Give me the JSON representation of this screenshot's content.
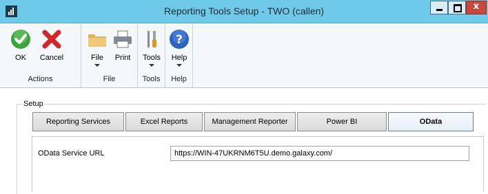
{
  "window": {
    "title": "Reporting Tools Setup  -  TWO (callen)",
    "icons": [
      "app-icon",
      "minimize-icon",
      "maximize-icon",
      "close-icon"
    ]
  },
  "ribbon": {
    "groups": [
      {
        "label": "Actions",
        "buttons": [
          {
            "label": "OK",
            "icon": "checkmark-icon",
            "color": "#3aa33a"
          },
          {
            "label": "Cancel",
            "icon": "x-icon",
            "color": "#d0282a"
          }
        ]
      },
      {
        "label": "File",
        "buttons": [
          {
            "label": "File",
            "icon": "folder-icon",
            "color": "#e2b25a"
          },
          {
            "label": "Print",
            "icon": "printer-icon",
            "color": "#7f8c98"
          }
        ]
      },
      {
        "label": "Tools",
        "buttons": [
          {
            "label": "Tools",
            "icon": "tools-icon",
            "color": "#d89b2a"
          }
        ]
      },
      {
        "label": "Help",
        "buttons": [
          {
            "label": "Help",
            "icon": "help-icon",
            "color": "#2a62c4"
          }
        ]
      }
    ]
  },
  "setup": {
    "legend": "Setup",
    "tabs": [
      {
        "label": "Reporting Services",
        "active": false
      },
      {
        "label": "Excel Reports",
        "active": false
      },
      {
        "label": "Management Reporter",
        "active": false
      },
      {
        "label": "Power BI",
        "active": false
      },
      {
        "label": "OData",
        "active": true
      }
    ],
    "odata_url_label": "OData Service URL",
    "odata_url_value": "https://WIN-47UKRNM6T5U.demo.galaxy.com/"
  }
}
